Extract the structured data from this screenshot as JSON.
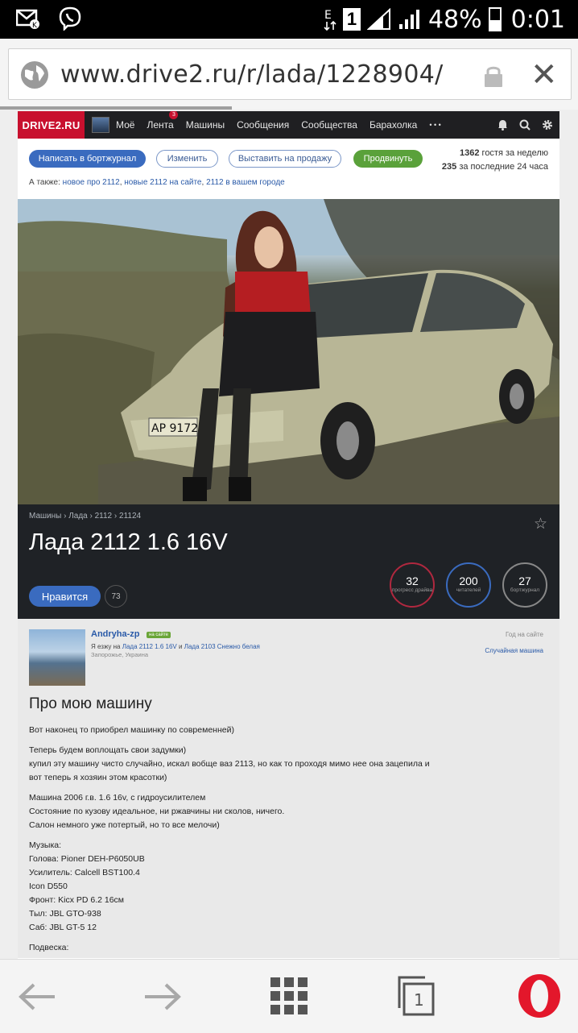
{
  "status_bar": {
    "battery": "48%",
    "time": "0:01",
    "sim": "1"
  },
  "browser": {
    "url": "www.drive2.ru/r/lada/1228904/",
    "tab_count": "1"
  },
  "nav": {
    "logo": "DRIVE2.RU",
    "items": [
      "Моё",
      "Лента",
      "Машины",
      "Сообщения",
      "Сообщества",
      "Барахолка"
    ],
    "feed_badge": "3",
    "more": "• • •"
  },
  "actions": {
    "write": "Написать в бортжурнал",
    "edit": "Изменить",
    "sell": "Выставить на продажу",
    "promote": "Продвинуть",
    "week_count": "1362",
    "week_label": "гостя за неделю",
    "day_count": "235",
    "day_label": "за последние 24 часа",
    "also_prefix": "А также:",
    "also_links": [
      "новое про 2112",
      "новые 2112 на сайте",
      "2112 в вашем городе"
    ]
  },
  "photo": {
    "plate": "AP 9172 C"
  },
  "car": {
    "breadcrumb": "Машины › Лада › 2112 › 21124",
    "title": "Лада 2112 1.6 16V",
    "like_label": "Нравится",
    "like_count": "73",
    "stats": [
      {
        "value": "32",
        "label": "прогресс драйва",
        "color": "#b0283f"
      },
      {
        "value": "200",
        "label": "читателей",
        "color": "#3a6bbf"
      },
      {
        "value": "27",
        "label": "бортжурнал",
        "color": "#888888"
      }
    ]
  },
  "owner": {
    "name": "Andryha-zp",
    "online": "на сайте",
    "drive_prefix": "Я езжу на",
    "car1": "Лада 2112 1.6 16V",
    "and": "и",
    "car2": "Лада 2103 Снежно белая",
    "location": "Запорожье, Украина",
    "year_label": "Год на сайте",
    "random_car": "Случайная машина"
  },
  "post": {
    "heading": "Про мою машину",
    "paragraphs": [
      "Вот наконец то приобрел машинку по современней)",
      "Теперь будем воплощать свои задумки)\nкупил эту машину чисто случайно, искал вобще ваз 2113, но как то проходя мимо нее она зацепила и\nвот теперь я хозяин этом красотки)",
      "Машина 2006 г.в. 1.6 16v, с гидроусилителем\nСостояние по кузову идеальное, ни ржавчины ни сколов, ничего.\nСалон немного уже потертый, но то все мелочи)",
      "Музыка:\nГолова: Pioner DEH-P6050UB\nУсилитель: Calcell BST100.4\nIcon D550\nФронт: Kicx PD 6.2 16см\nТыл: JBL GTO-938\nСаб: JBL GT-5 12",
      "Подвеска:"
    ]
  }
}
